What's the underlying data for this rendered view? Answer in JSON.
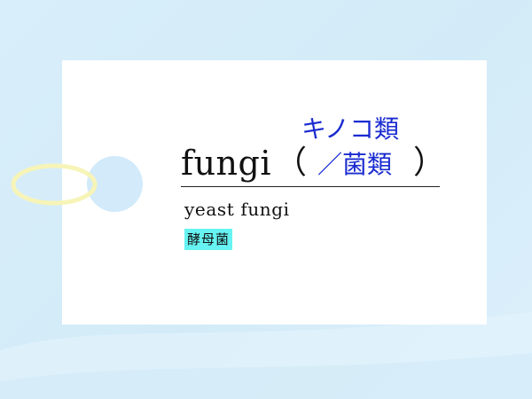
{
  "card": {
    "headword": "fungi",
    "paren_open": "（",
    "paren_close": "）",
    "translation": "／菌類",
    "reading": "キノコ類",
    "example_en": "yeast fungi",
    "example_ja": "酵母菌"
  },
  "colors": {
    "background": "#d6edf9",
    "card": "#ffffff",
    "hole": "#d2eafa",
    "ring": "#f7f4b8",
    "translation_text": "#1a2bd0",
    "highlight": "#66f3f2"
  },
  "icons": {
    "ring": "keyring-icon",
    "hole": "card-hole-icon"
  }
}
